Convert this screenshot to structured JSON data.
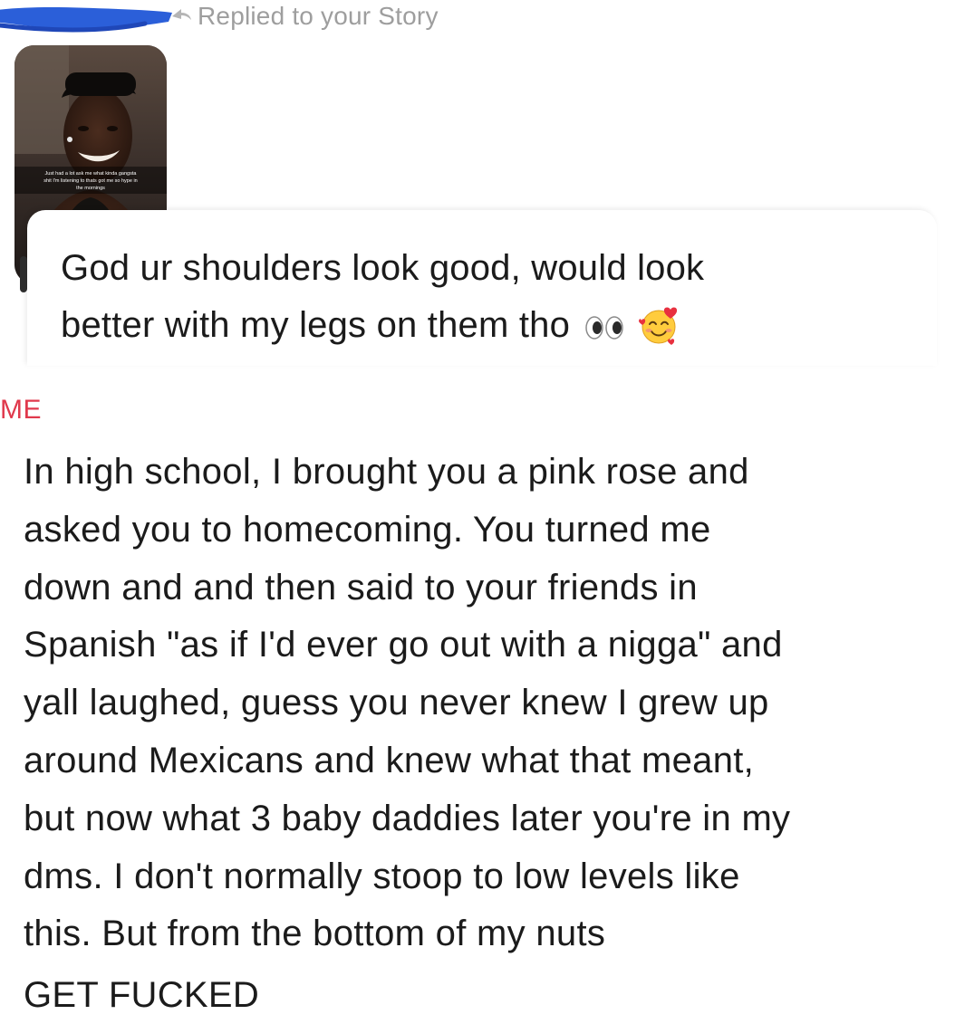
{
  "header": {
    "replied_label": "Replied to your Story"
  },
  "story": {
    "caption_lines": [
      "Just had a lot ask me what kinda gangsta",
      "shit I'm listening to thats got me so hype in",
      "the mornings"
    ]
  },
  "reply": {
    "message_line_1": "God ur shoulders look good, would look",
    "message_line_2": "better with my legs on them tho",
    "emojis": [
      "eyes-icon",
      "smiling-face-with-hearts-icon"
    ]
  },
  "conversation": {
    "sender_label": "ME",
    "message_lines": [
      "In high school, I brought you a pink rose and",
      "asked you to homecoming. You turned me",
      "down and and then said to your friends in",
      "Spanish \"as if I'd ever go out with a nigga\"  and",
      "yall laughed, guess you never knew I grew up",
      "around Mexicans and knew what that meant,",
      "but now what 3 baby daddies later you're in my",
      "dms. I don't normally stoop to low levels like",
      "this. But from the bottom of my nuts"
    ],
    "final_line": "GET FUCKED"
  },
  "colors": {
    "sender_label": "#e0394c",
    "redaction_scribble": "#2b5fd9",
    "secondary_text": "#9e9e9e"
  }
}
